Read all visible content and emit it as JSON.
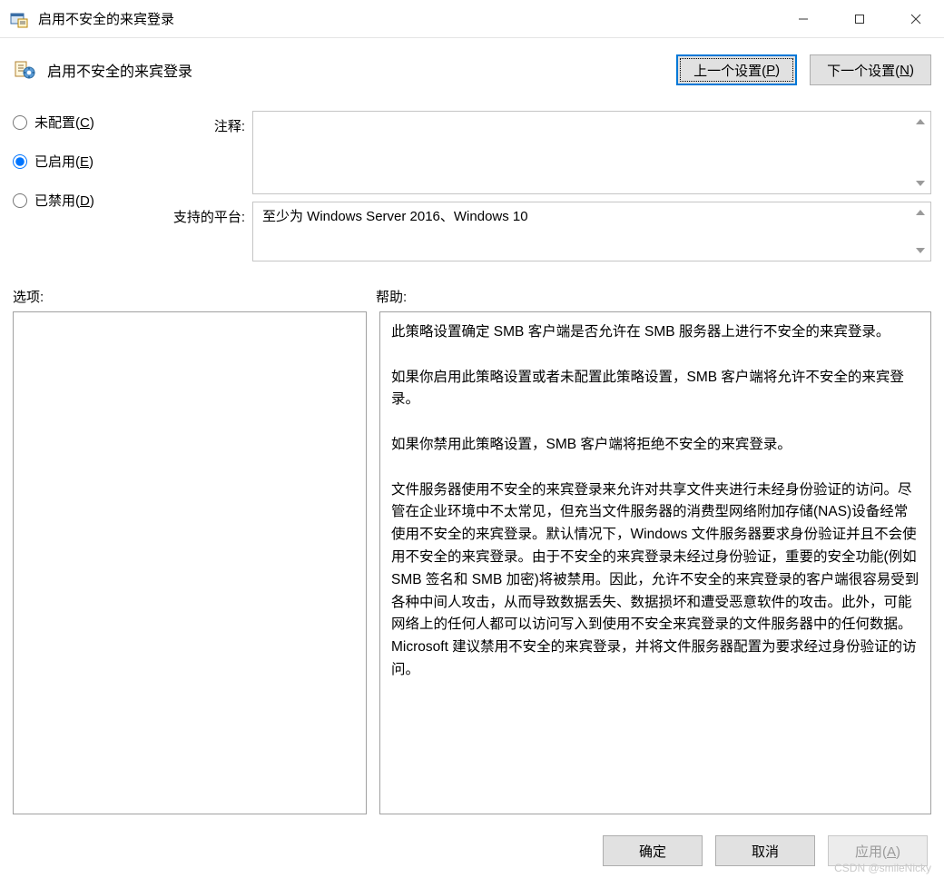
{
  "window": {
    "title": "启用不安全的来宾登录"
  },
  "header": {
    "policy_title": "启用不安全的来宾登录",
    "prev_button_pre": "上一个设置(",
    "prev_button_key": "P",
    "prev_button_post": ")",
    "next_button_pre": "下一个设置(",
    "next_button_key": "N",
    "next_button_post": ")"
  },
  "radios": {
    "not_configured_pre": "未配置(",
    "not_configured_key": "C",
    "not_configured_post": ")",
    "enabled_pre": "已启用(",
    "enabled_key": "E",
    "enabled_post": ")",
    "disabled_pre": "已禁用(",
    "disabled_key": "D",
    "disabled_post": ")",
    "selected": "enabled"
  },
  "fields": {
    "comment_label": "注释:",
    "comment_value": "",
    "supported_label": "支持的平台:",
    "supported_value": "至少为 Windows Server 2016、Windows 10"
  },
  "panels": {
    "options_label": "选项:",
    "help_label": "帮助:",
    "options_content": "",
    "help_content": "此策略设置确定 SMB 客户端是否允许在 SMB 服务器上进行不安全的来宾登录。\n\n如果你启用此策略设置或者未配置此策略设置，SMB 客户端将允许不安全的来宾登录。\n\n如果你禁用此策略设置，SMB 客户端将拒绝不安全的来宾登录。\n\n文件服务器使用不安全的来宾登录来允许对共享文件夹进行未经身份验证的访问。尽管在企业环境中不太常见，但充当文件服务器的消费型网络附加存储(NAS)设备经常使用不安全的来宾登录。默认情况下，Windows 文件服务器要求身份验证并且不会使用不安全的来宾登录。由于不安全的来宾登录未经过身份验证，重要的安全功能(例如 SMB 签名和 SMB 加密)将被禁用。因此，允许不安全的来宾登录的客户端很容易受到各种中间人攻击，从而导致数据丢失、数据损坏和遭受恶意软件的攻击。此外，可能网络上的任何人都可以访问写入到使用不安全来宾登录的文件服务器中的任何数据。Microsoft 建议禁用不安全的来宾登录，并将文件服务器配置为要求经过身份验证的访问。"
  },
  "buttons": {
    "ok": "确定",
    "cancel": "取消",
    "apply_pre": "应用(",
    "apply_key": "A",
    "apply_post": ")"
  },
  "watermark": "CSDN @smileNicky"
}
